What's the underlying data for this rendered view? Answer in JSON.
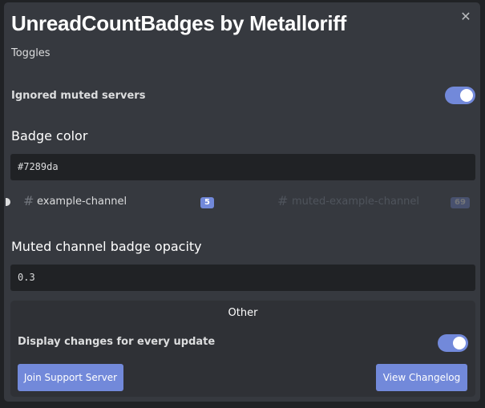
{
  "modal": {
    "title": "UnreadCountBadges by Metalloriff",
    "close_icon": "✕"
  },
  "toggles": {
    "heading": "Toggles",
    "ignored_muted_servers": {
      "label": "Ignored muted servers",
      "enabled": true
    }
  },
  "badge_color": {
    "heading": "Badge color",
    "value": "#7289da"
  },
  "preview": {
    "channel": {
      "hash": "#",
      "name": "example-channel",
      "count": "5"
    },
    "muted_channel": {
      "hash": "#",
      "name": "muted-example-channel",
      "count": "69"
    },
    "badge_color": "#7289da",
    "muted_opacity": 0.3
  },
  "muted_opacity": {
    "heading": "Muted channel badge opacity",
    "value": "0.3"
  },
  "other": {
    "heading": "Other",
    "display_changes": {
      "label": "Display changes for every update",
      "enabled": true
    },
    "support_button": "Join Support Server",
    "changelog_button": "View Changelog"
  },
  "colors": {
    "accent": "#7289da",
    "modal_bg": "#36393f",
    "input_bg": "#202225"
  }
}
